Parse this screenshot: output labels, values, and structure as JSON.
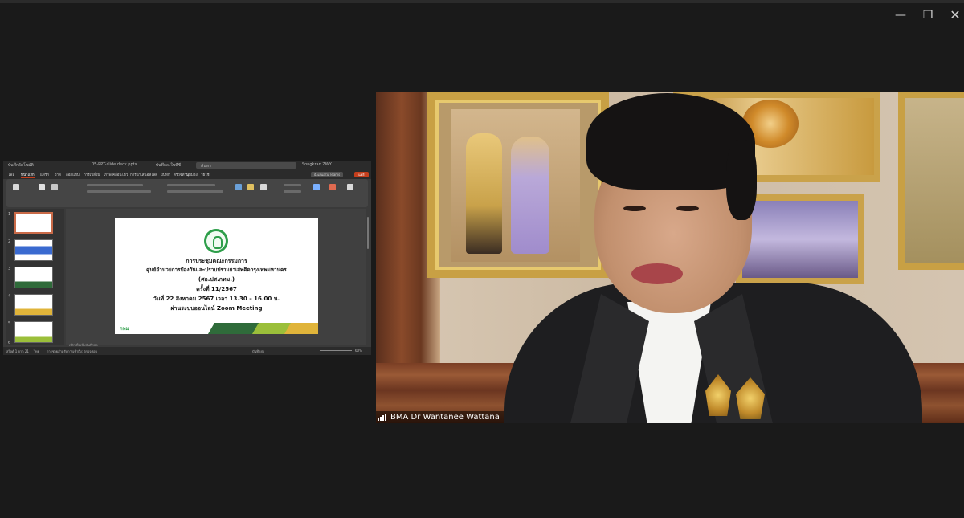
{
  "window": {
    "minimize_icon": "minimize-icon",
    "maximize_icon": "restore-icon",
    "close_icon": "close-icon"
  },
  "powerpoint": {
    "title_items": [
      "บันทึกอัตโนมัติ",
      "05-PPT-slide deck.pptx",
      "บันทึกลงในพีซี",
      "ค้นหา",
      "Songkran ZWY"
    ],
    "menu_tabs": [
      "ไฟล์",
      "หน้าแรก",
      "แทรก",
      "วาด",
      "ออกแบบ",
      "การเปลี่ยน",
      "ภาพเคลื่อนไหว",
      "การนำเสนอสไลด์",
      "บันทึก",
      "ตรวจทาน",
      "มุมมอง",
      "วิธีใช้"
    ],
    "active_tab": "หน้าแรก",
    "share_button": "แชร์",
    "present_button": "นำเสนอใน Teams",
    "slide_numbers": [
      "1",
      "2",
      "3",
      "4",
      "5",
      "6"
    ],
    "notes_placeholder": "คลิกเพื่อเพิ่มบันทึกย่อ",
    "status_left": "สไลด์ 1 จาก 21",
    "status_language": "ไทย",
    "status_accessibility": "การช่วยสำหรับการเข้าถึง: ตรวจสอบ",
    "status_notes": "บันทึกย่อ",
    "status_zoom": "60%"
  },
  "slide": {
    "line1": "การประชุมคณะกรรมการ",
    "line2": "ศูนย์อำนวยการป้องกันและปราบปรามยาเสพติดกรุงเทพมหานคร",
    "line3": "(ศอ.ปส.กทม.)",
    "line4": "ครั้งที่ 11/2567",
    "line5": "วันที่ 22 สิงหาคม 2567 เวลา 13.30 – 16.00 น.",
    "line6": "ผ่านระบบออนไลน์ Zoom Meeting",
    "footer_logo": "กทม"
  },
  "video": {
    "participant_name": "BMA Dr Wantanee Wattana",
    "signal_icon": "signal-strength-icon"
  },
  "colors": {
    "background": "#1a1a1a",
    "ppt_accent": "#c43e1c",
    "slide_green": "#2e9e4a"
  }
}
